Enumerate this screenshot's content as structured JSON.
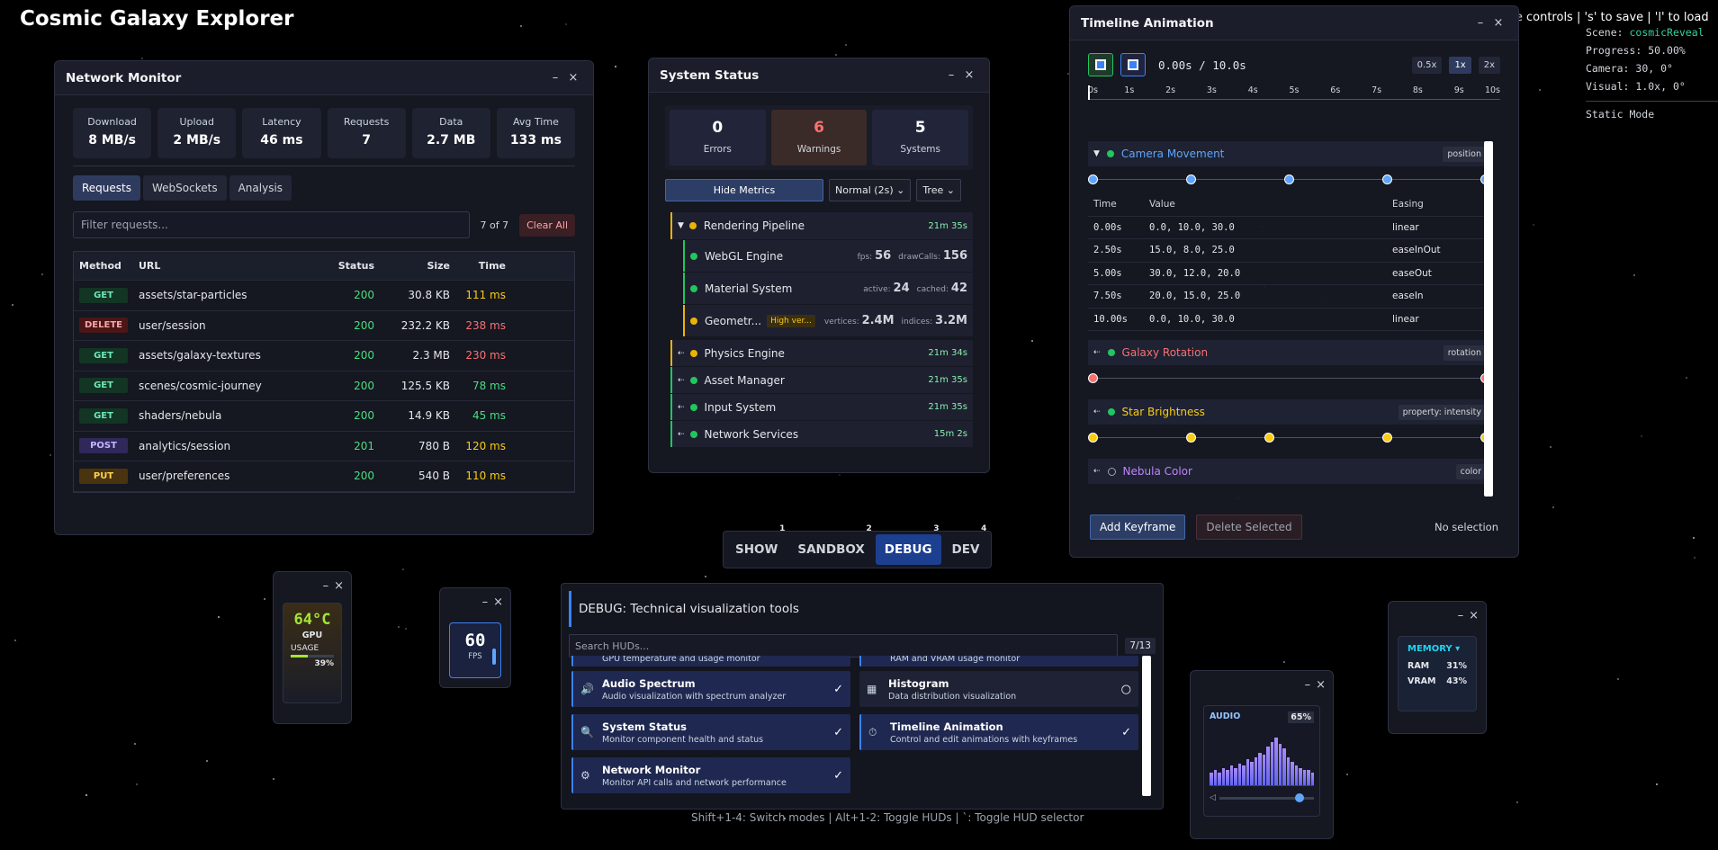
{
  "app": {
    "title": "Cosmic Galaxy Explorer",
    "hint_top": "gle controls | 's' to save | 'l' to load"
  },
  "debug_info": {
    "scene_label": "Scene:",
    "scene": "cosmicReveal",
    "progress_label": "Progress:",
    "progress": "50.00%",
    "camera_label": "Camera:",
    "camera": "30, 0°",
    "visual_label": "Visual:",
    "visual": "1.0x, 0°",
    "mode": "Static Mode"
  },
  "network": {
    "title": "Network Monitor",
    "stats": [
      {
        "label": "Download",
        "value": "8 MB/s"
      },
      {
        "label": "Upload",
        "value": "2 MB/s"
      },
      {
        "label": "Latency",
        "value": "46 ms"
      },
      {
        "label": "Requests",
        "value": "7"
      },
      {
        "label": "Data",
        "value": "2.7 MB"
      },
      {
        "label": "Avg Time",
        "value": "133 ms"
      }
    ],
    "tabs": [
      "Requests",
      "WebSockets",
      "Analysis"
    ],
    "filter_placeholder": "Filter requests...",
    "count": "7 of 7",
    "clear": "Clear All",
    "columns": [
      "Method",
      "URL",
      "Status",
      "Size",
      "Time"
    ],
    "rows": [
      {
        "method": "GET",
        "url": "assets/star-particles",
        "status": "200",
        "size": "30.8 KB",
        "time": "111 ms",
        "tc": "#facc15"
      },
      {
        "method": "DELETE",
        "url": "user/session",
        "status": "200",
        "size": "232.2 KB",
        "time": "238 ms",
        "tc": "#f87171"
      },
      {
        "method": "GET",
        "url": "assets/galaxy-textures",
        "status": "200",
        "size": "2.3 MB",
        "time": "230 ms",
        "tc": "#f87171"
      },
      {
        "method": "GET",
        "url": "scenes/cosmic-journey",
        "status": "200",
        "size": "125.5 KB",
        "time": "78 ms",
        "tc": "#4ade80"
      },
      {
        "method": "GET",
        "url": "shaders/nebula",
        "status": "200",
        "size": "14.9 KB",
        "time": "45 ms",
        "tc": "#4ade80"
      },
      {
        "method": "POST",
        "url": "analytics/session",
        "status": "201",
        "size": "780 B",
        "time": "120 ms",
        "tc": "#facc15"
      },
      {
        "method": "PUT",
        "url": "user/preferences",
        "status": "200",
        "size": "540 B",
        "time": "110 ms",
        "tc": "#facc15"
      }
    ]
  },
  "system": {
    "title": "System Status",
    "errors": "0",
    "errors_label": "Errors",
    "warnings": "6",
    "warnings_label": "Warnings",
    "systems": "5",
    "systems_label": "Systems",
    "hide_metrics": "Hide Metrics",
    "interval": "Normal (2s)",
    "view": "Tree",
    "rendering": {
      "name": "Rendering Pipeline",
      "time": "21m 35s"
    },
    "webgl": {
      "name": "WebGL Engine",
      "m1k": "fps:",
      "m1v": "56",
      "m2k": "drawCalls:",
      "m2v": "156"
    },
    "material": {
      "name": "Material System",
      "m1k": "active:",
      "m1v": "24",
      "m2k": "cached:",
      "m2v": "42"
    },
    "geometry": {
      "name": "Geometr...",
      "badge": "High ver...",
      "m1k": "vertices:",
      "m1v": "2.4M",
      "m2k": "indices:",
      "m2v": "3.2M"
    },
    "others": [
      {
        "name": "Physics Engine",
        "time": "21m 34s",
        "c": "y"
      },
      {
        "name": "Asset Manager",
        "time": "21m 35s",
        "c": "g"
      },
      {
        "name": "Input System",
        "time": "21m 35s",
        "c": "g"
      },
      {
        "name": "Network Services",
        "time": "15m 2s",
        "c": "g"
      }
    ]
  },
  "timeline": {
    "title": "Timeline Animation",
    "time": "0.00s / 10.0s",
    "speeds": [
      "0.5x",
      "1x",
      "2x"
    ],
    "ticks": [
      "0s",
      "1s",
      "2s",
      "3s",
      "4s",
      "5s",
      "6s",
      "7s",
      "8s",
      "9s",
      "10s"
    ],
    "camera": {
      "name": "Camera Movement",
      "badge": "position",
      "color": "#60a5fa"
    },
    "kf_columns": [
      "Time",
      "Value",
      "Easing"
    ],
    "keyframes": [
      {
        "t": "0.00s",
        "v": "0.0, 10.0, 30.0",
        "e": "linear"
      },
      {
        "t": "2.50s",
        "v": "15.0, 8.0, 25.0",
        "e": "easeInOut"
      },
      {
        "t": "5.00s",
        "v": "30.0, 12.0, 20.0",
        "e": "easeOut"
      },
      {
        "t": "7.50s",
        "v": "20.0, 15.0, 25.0",
        "e": "easeIn"
      },
      {
        "t": "10.00s",
        "v": "0.0, 10.0, 30.0",
        "e": "linear"
      }
    ],
    "galaxy": {
      "name": "Galaxy Rotation",
      "badge": "rotation",
      "color": "#f87171"
    },
    "star": {
      "name": "Star Brightness",
      "badge": "property: intensity",
      "color": "#facc15"
    },
    "nebula": {
      "name": "Nebula Color",
      "badge": "color",
      "color": "#c084fc"
    },
    "add": "Add Keyframe",
    "delete": "Delete Selected",
    "selection": "No selection"
  },
  "modes": [
    {
      "label": "SHOW",
      "key": "1"
    },
    {
      "label": "SANDBOX",
      "key": "2"
    },
    {
      "label": "DEBUG",
      "key": "3"
    },
    {
      "label": "DEV",
      "key": "4"
    }
  ],
  "selector": {
    "title": "DEBUG: Technical visualization tools",
    "search_placeholder": "Search HUDs...",
    "count": "7/13",
    "partial_left": "GPU temperature and usage monitor",
    "partial_right": "RAM and VRAM usage monitor",
    "cards": [
      {
        "name": "Audio Spectrum",
        "desc": "Audio visualization with spectrum analyzer",
        "check": "✓"
      },
      {
        "name": "Histogram",
        "desc": "Data distribution visualization",
        "check": "○"
      },
      {
        "name": "System Status",
        "desc": "Monitor component health and status",
        "check": "✓"
      },
      {
        "name": "Timeline Animation",
        "desc": "Control and edit animations with keyframes",
        "check": "✓"
      },
      {
        "name": "Network Monitor",
        "desc": "Monitor API calls and network performance",
        "check": "✓"
      }
    ]
  },
  "footer_hint": "Shift+1-4: Switch modes | Alt+1-2: Toggle HUDs | `: Toggle HUD selector",
  "gpu": {
    "temp": "64°C",
    "label": "GPU",
    "usage_label": "USAGE",
    "usage": "39%",
    "usage_level": 0.39
  },
  "fps": {
    "value": "60",
    "label": "FPS"
  },
  "audio": {
    "label": "AUDIO",
    "level": "65%"
  },
  "memory": {
    "label": "MEMORY ▾",
    "ram_label": "RAM",
    "ram": "31%",
    "vram_label": "VRAM",
    "vram": "43%"
  },
  "window_controls": {
    "min": "–",
    "close": "×"
  }
}
